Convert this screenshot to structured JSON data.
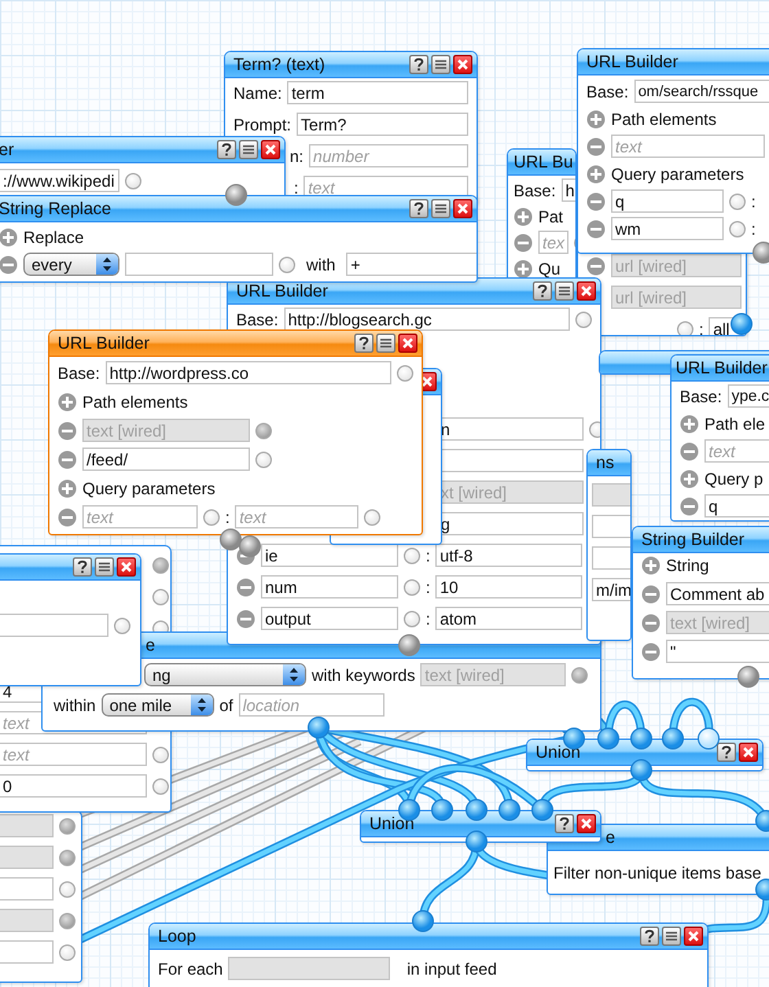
{
  "canvas": {
    "modules": [
      {
        "selected": false,
        "rows": [
          {
            "kind": "field",
            "field": {
              "wired": true
            }
          },
          {
            "kind": "field",
            "field": {
              "wired": true
            }
          },
          {
            "kind": "field",
            "field": {
              "wired": false
            }
          },
          {
            "kind": "field",
            "field": {
              "wired": true
            }
          },
          {
            "kind": "field",
            "field": {
              "wired": false
            }
          }
        ]
      },
      {
        "selected": false,
        "rows": [
          {
            "kind": "port",
            "wired": true
          },
          {
            "kind": "port",
            "wired": false
          },
          {
            "kind": "port",
            "wired": false
          },
          {
            "kind": "field",
            "field": {
              "value": "4",
              "wired": false
            }
          },
          {
            "kind": "field",
            "field": {
              "placeholder": "text",
              "wired": false
            }
          },
          {
            "kind": "field",
            "field": {
              "placeholder": "text",
              "wired": false
            }
          },
          {
            "kind": "field",
            "field": {
              "value": "0",
              "wired": false
            }
          }
        ]
      },
      {
        "title": "Loop",
        "selected": false,
        "help_button": true,
        "collapse_button": true,
        "close_button": true,
        "rows": [
          {
            "kind": "loop",
            "label": "For each",
            "field": {
              "wired": true
            },
            "label_2": "in input feed"
          }
        ]
      },
      {
        "title": "e",
        "selected": false,
        "rows": [
          {
            "kind": "text",
            "text": "Filter non-unique items base"
          }
        ]
      },
      {
        "title": "Union",
        "selected": false,
        "help_button": true,
        "close_button": true
      },
      {
        "title": "Union",
        "selected": false,
        "help_button": true,
        "close_button": true
      },
      {
        "title": "e",
        "selected": false,
        "rows": [
          {
            "kind": "keywords",
            "select": "ng",
            "label": "with keywords",
            "field": {
              "placeholder": "text [wired]",
              "wired": true
            }
          },
          {
            "kind": "within",
            "label": "within",
            "select": "one mile",
            "label_2": "of",
            "field": {
              "placeholder": "location",
              "wired": false
            }
          }
        ]
      },
      {
        "selected": false,
        "help_button": true,
        "collapse_button": true,
        "close_button": true,
        "rows": [
          {
            "kind": "field",
            "field": {
              "wired": false
            }
          }
        ]
      },
      {
        "title": "URL Bu",
        "selected": false,
        "rows": [
          {
            "kind": "base",
            "label": "Base:",
            "field": {
              "value": "h",
              "wired": false
            }
          },
          {
            "kind": "heading",
            "label": "Pat"
          },
          {
            "kind": "item",
            "field": {
              "placeholder": "tex",
              "wired": false
            }
          },
          {
            "kind": "heading",
            "label": "Qu"
          }
        ]
      },
      {
        "selected": false,
        "rows": [
          {
            "kind": "item",
            "field": {
              "placeholder": "url [wired]",
              "wired": true
            }
          },
          {
            "kind": "field",
            "field": {
              "placeholder": "url [wired]",
              "wired": true
            }
          },
          {
            "kind": "pair",
            "separator": ":",
            "right": {
              "value": "all",
              "wired": false
            }
          }
        ]
      },
      {
        "title": "URL Builder",
        "selected": false,
        "help_button": true,
        "collapse_button": true,
        "close_button": true,
        "rows": [
          {
            "kind": "base",
            "label": "Base:",
            "field": {
              "value": "http://blogsearch.gc",
              "wired": false
            }
          },
          {
            "kind": "pair",
            "right": {
              "value": "n",
              "wired": false
            }
          },
          {
            "kind": "pair",
            "right": {
              "wired": false
            }
          },
          {
            "kind": "pair",
            "right": {
              "placeholder": "xt [wired]",
              "wired": true
            }
          },
          {
            "kind": "pair",
            "right": {
              "value": "g",
              "wired": false
            }
          },
          {
            "kind": "pair",
            "left": {
              "value": "ie",
              "wired": false
            },
            "separator": ":",
            "right": {
              "value": "utf-8",
              "wired": false
            }
          },
          {
            "kind": "pair",
            "left": {
              "value": "num",
              "wired": false
            },
            "separator": ":",
            "right": {
              "value": "10",
              "wired": false
            }
          },
          {
            "kind": "pair",
            "left": {
              "value": "output",
              "wired": false
            },
            "separator": ":",
            "right": {
              "value": "atom",
              "wired": false
            }
          }
        ]
      },
      {
        "selected": false,
        "close_button": true
      },
      {
        "title": "URL Builder",
        "selected": true,
        "help_button": true,
        "collapse_button": true,
        "close_button": true,
        "rows": [
          {
            "kind": "base",
            "label": "Base:",
            "field": {
              "value": "http://wordpress.co",
              "wired": false
            }
          },
          {
            "kind": "heading",
            "label": "Path elements"
          },
          {
            "kind": "item",
            "field": {
              "placeholder": "text [wired]",
              "wired": true
            }
          },
          {
            "kind": "item",
            "field": {
              "value": "/feed/",
              "wired": false
            }
          },
          {
            "kind": "heading",
            "label": "Query parameters"
          },
          {
            "kind": "pair",
            "left": {
              "placeholder": "text",
              "wired": false
            },
            "separator": ":",
            "right": {
              "placeholder": "text",
              "wired": false
            }
          }
        ]
      },
      {
        "title": "er",
        "selected": false,
        "help_button": true,
        "collapse_button": true,
        "close_button": true,
        "rows": [
          {
            "kind": "field",
            "field": {
              "value": "://www.wikipedi",
              "wired": false
            }
          }
        ]
      },
      {
        "title": "Term? (text)",
        "selected": false,
        "help_button": true,
        "collapse_button": true,
        "close_button": true,
        "rows": [
          {
            "kind": "labeled",
            "label": "Name:",
            "field": {
              "value": "term",
              "wired": false
            }
          },
          {
            "kind": "labeled",
            "label": "Prompt:",
            "field": {
              "value": "Term?",
              "wired": false
            }
          },
          {
            "kind": "labeled",
            "label": "n:",
            "field": {
              "placeholder": "number",
              "wired": false
            }
          },
          {
            "kind": "labeled",
            "label": ":",
            "field": {
              "placeholder": "text",
              "wired": false
            }
          }
        ]
      },
      {
        "title": "String Replace",
        "selected": false,
        "help_button": true,
        "collapse_button": true,
        "close_button": true,
        "rows": [
          {
            "kind": "heading",
            "label": "Replace"
          },
          {
            "kind": "replace",
            "select": "every",
            "field": {
              "wired": false
            },
            "label": "with",
            "replacement": {
              "value": "+",
              "wired": false
            }
          }
        ]
      },
      {
        "title": "URL Builder",
        "selected": false,
        "rows": [
          {
            "kind": "base",
            "label": "Base:",
            "field": {
              "value": "om/search/rssque",
              "wired": false
            }
          },
          {
            "kind": "heading",
            "label": "Path elements"
          },
          {
            "kind": "item",
            "field": {
              "placeholder": "text",
              "wired": false
            }
          },
          {
            "kind": "heading",
            "label": "Query parameters"
          },
          {
            "kind": "pair",
            "left": {
              "value": "q",
              "wired": false
            },
            "separator": ":"
          },
          {
            "kind": "pair",
            "left": {
              "value": "wm",
              "wired": false
            },
            "separator": ":"
          }
        ]
      },
      {
        "selected": false
      },
      {
        "title": "ns",
        "selected": false,
        "rows": [
          {
            "kind": "field",
            "field": {
              "wired": true
            }
          },
          {
            "kind": "field",
            "field": {
              "wired": false
            }
          },
          {
            "kind": "field",
            "field": {
              "wired": false
            }
          },
          {
            "kind": "field",
            "field": {
              "value": "m/im",
              "wired": false
            }
          }
        ]
      },
      {
        "title": "URL Builder",
        "selected": false,
        "rows": [
          {
            "kind": "base",
            "label": "Base:",
            "field": {
              "value": "ype.c",
              "wired": false
            }
          },
          {
            "kind": "heading",
            "label": "Path ele"
          },
          {
            "kind": "item",
            "field": {
              "placeholder": "text",
              "wired": false
            }
          },
          {
            "kind": "heading",
            "label": "Query p"
          },
          {
            "kind": "item",
            "field": {
              "value": "q",
              "wired": false
            }
          }
        ]
      },
      {
        "title": "String Builder",
        "selected": false,
        "rows": [
          {
            "kind": "heading",
            "label": "String"
          },
          {
            "kind": "item",
            "field": {
              "value": "Comment ab",
              "wired": false
            }
          },
          {
            "kind": "item",
            "field": {
              "placeholder": "text [wired]",
              "wired": true
            }
          },
          {
            "kind": "item",
            "field": {
              "value": "\"",
              "wired": false
            }
          }
        ]
      }
    ]
  }
}
